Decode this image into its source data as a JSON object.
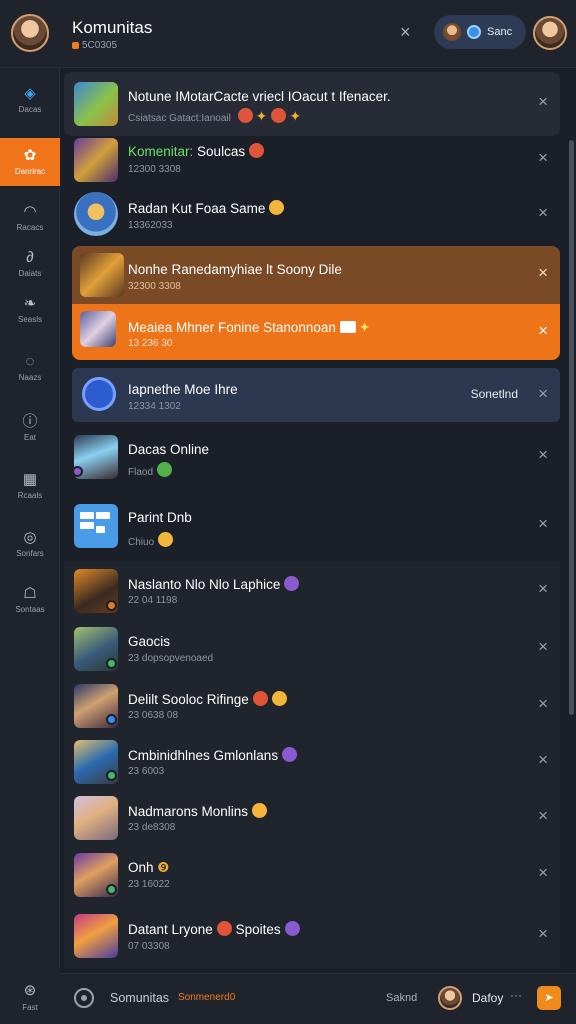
{
  "header": {
    "title": "Komunitas",
    "subtitle": "5C0305",
    "close_icon": "×",
    "pill_label": "Sanc"
  },
  "sidebar": {
    "items": [
      {
        "label": "Dacas",
        "icon": "brand-icon"
      },
      {
        "label": "Danrirac",
        "icon": "community-icon",
        "active": true
      },
      {
        "label": "Racacs",
        "icon": "chat-icon"
      },
      {
        "label": "Daiats",
        "icon": "clip-icon"
      },
      {
        "label": "Seasls",
        "icon": "leaf-icon"
      },
      {
        "label": "Naazs",
        "icon": "bubble-icon"
      },
      {
        "label": "Eat",
        "icon": "info-icon"
      },
      {
        "label": "Rcaals",
        "icon": "calendar-icon"
      },
      {
        "label": "Sonfars",
        "icon": "gear-icon"
      },
      {
        "label": "Sontaas",
        "icon": "bot-icon"
      }
    ],
    "bottom_item": {
      "label": "Fast",
      "icon": "globe-icon"
    }
  },
  "rows": [
    {
      "name": "Notune IMotarCacte vriecl IOacut t Ifenacer.",
      "meta": "Csiatsac Gatact:Ianoail"
    },
    {
      "name_accent": "Komenitar:",
      "name": "Soulcas",
      "meta": "12300 3308"
    },
    {
      "name": "Radan Kut Foaa Same",
      "meta": "13362033"
    },
    {
      "name": "Nonhe Ranedamyhiae lt Soony Dile",
      "meta": "32300 3308"
    },
    {
      "name": "Meaiea Mhner Fonine Stanonnoan",
      "meta": "13 236 30"
    },
    {
      "name": "Iapnethe Moe Ihre",
      "meta": "12334 1302",
      "action": "Sonetlnd"
    },
    {
      "name": "Dacas Online",
      "meta": "Flaod"
    },
    {
      "name": "Parint Dnb",
      "meta": "Chiuo"
    },
    {
      "name": "Naslanto Nlo Nlo Laphice",
      "meta": "22 04 1198"
    },
    {
      "name": "Gaocis",
      "meta": "23 dopsopvenoaed"
    },
    {
      "name": "Delilt Sooloc Rifinge",
      "meta": "23 0638 08"
    },
    {
      "name": "Cmbinidhlnes Gmlonlans",
      "meta": "23 6003"
    },
    {
      "name": "Nadmarons Monlins",
      "meta": "23 de8308"
    },
    {
      "name": "Onh",
      "meta": "23 16022"
    },
    {
      "name": "Datant Lryone",
      "name_tail": "Spoites",
      "meta": "07 03308"
    }
  ],
  "bottom_bar": {
    "label": "Somunitas",
    "label_accent": "Sonmenerd0",
    "mid": "Saknd",
    "user": "Dafoy",
    "more": "···"
  },
  "colors": {
    "accent": "#f0751a",
    "brown_row": "#7a4a26",
    "orange_row": "#ee7419",
    "slate_row": "#2c3750",
    "background": "#1b1f27"
  }
}
